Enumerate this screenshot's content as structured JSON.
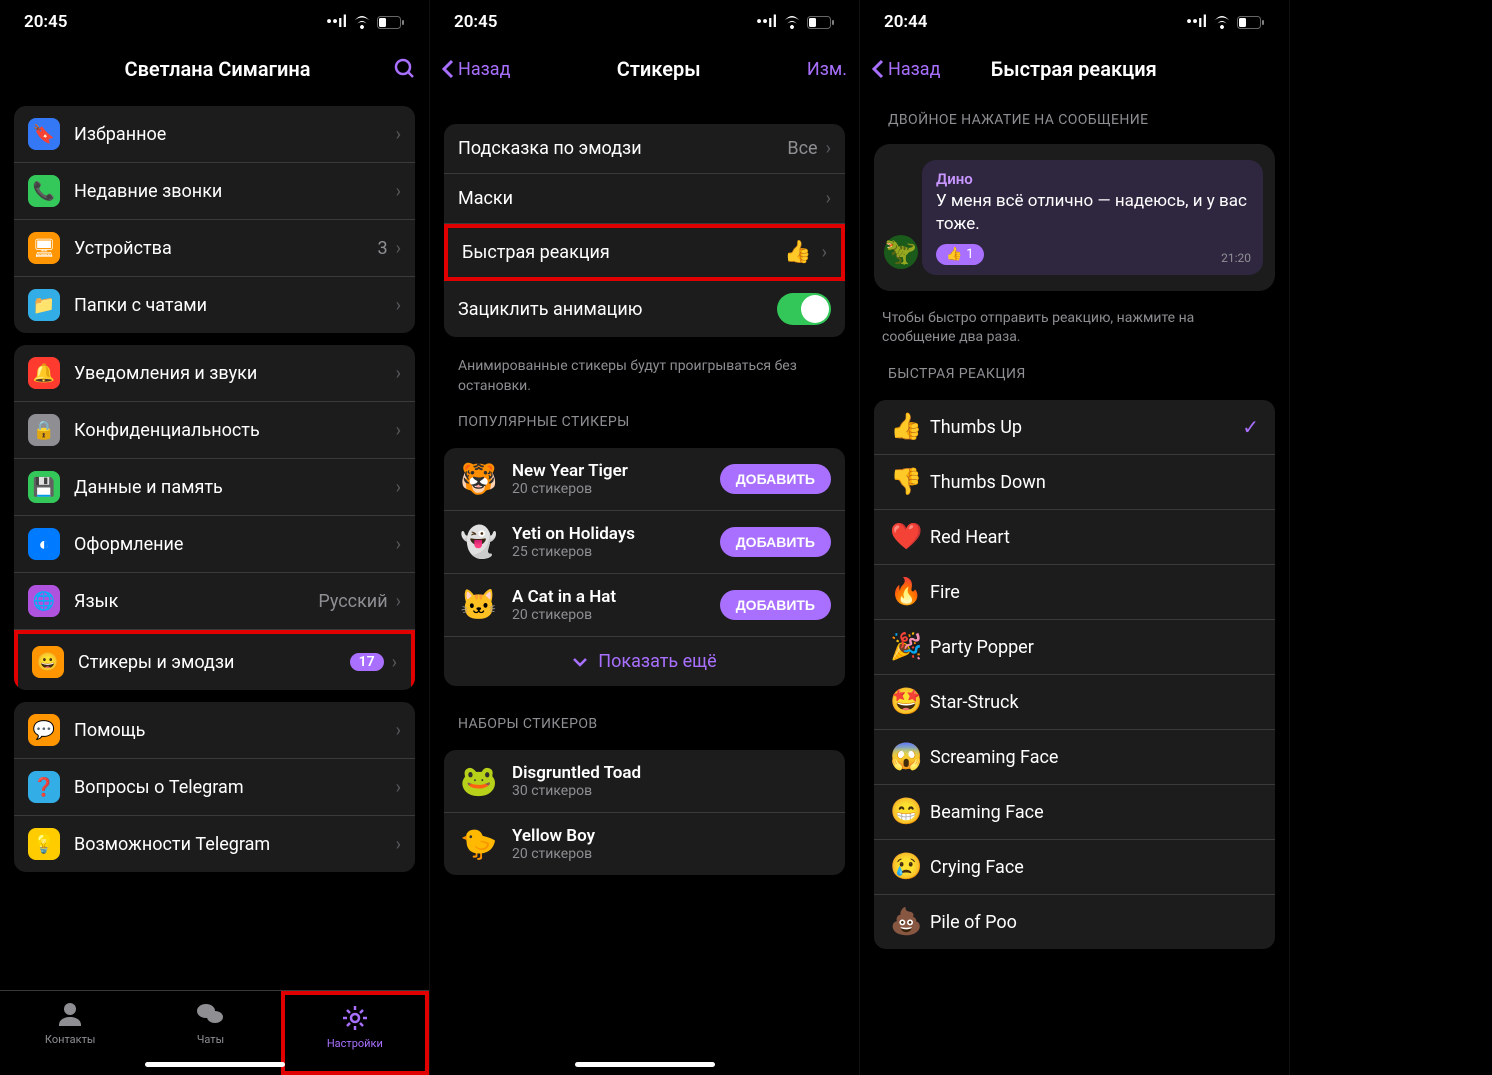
{
  "screen1": {
    "status_time": "20:45",
    "title": "Светлана Симагина",
    "group1": [
      {
        "icon": "🔖",
        "icon_bg": "#3478f6",
        "label": "Избранное"
      },
      {
        "icon": "📞",
        "icon_bg": "#34c759",
        "label": "Недавние звонки"
      },
      {
        "icon": "🖥",
        "icon_bg": "#ff9500",
        "label": "Устройства",
        "value": "3"
      },
      {
        "icon": "📁",
        "icon_bg": "#32ade6",
        "label": "Папки с чатами"
      }
    ],
    "group2": [
      {
        "icon": "🔔",
        "icon_bg": "#ff3b30",
        "label": "Уведомления и звуки"
      },
      {
        "icon": "🔒",
        "icon_bg": "#8e8e93",
        "label": "Конфиденциальность"
      },
      {
        "icon": "💾",
        "icon_bg": "#34c759",
        "label": "Данные и память"
      },
      {
        "icon": "◐",
        "icon_bg": "#007aff",
        "label": "Оформление"
      },
      {
        "icon": "🌐",
        "icon_bg": "#af52de",
        "label": "Язык",
        "value": "Русский"
      },
      {
        "icon": "😀",
        "icon_bg": "#ff9500",
        "label": "Стикеры и эмодзи",
        "badge": "17",
        "highlight": true
      }
    ],
    "group3": [
      {
        "icon": "💬",
        "icon_bg": "#ff9500",
        "label": "Помощь"
      },
      {
        "icon": "❓",
        "icon_bg": "#32ade6",
        "label": "Вопросы о Telegram"
      },
      {
        "icon": "💡",
        "icon_bg": "#ffcc00",
        "label": "Возможности Telegram"
      }
    ],
    "tabs": [
      {
        "label": "Контакты"
      },
      {
        "label": "Чаты"
      },
      {
        "label": "Настройки",
        "active": true,
        "highlight": true
      }
    ]
  },
  "screen2": {
    "status_time": "20:45",
    "back": "Назад",
    "title": "Стикеры",
    "edit": "Изм.",
    "rows": [
      {
        "label": "Подсказка по эмодзи",
        "value": "Все"
      },
      {
        "label": "Маски"
      },
      {
        "label": "Быстрая реакция",
        "emoji": "👍",
        "highlight": true
      },
      {
        "label": "Зациклить анимацию",
        "toggle": true
      }
    ],
    "footer1": "Анимированные стикеры будут проигрываться без остановки.",
    "popular_header": "ПОПУЛЯРНЫЕ СТИКЕРЫ",
    "popular": [
      {
        "thumb": "🐯",
        "name": "New Year Tiger",
        "count": "20 стикеров",
        "btn": "ДОБАВИТЬ"
      },
      {
        "thumb": "👻",
        "name": "Yeti on Holidays",
        "count": "25 стикеров",
        "btn": "ДОБАВИТЬ"
      },
      {
        "thumb": "🐱",
        "name": "A Cat in a Hat",
        "count": "20 стикеров",
        "btn": "ДОБАВИТЬ"
      }
    ],
    "show_more": "Показать ещё",
    "sets_header": "НАБОРЫ СТИКЕРОВ",
    "sets": [
      {
        "thumb": "🐸",
        "name": "Disgruntled Toad",
        "count": "30 стикеров"
      },
      {
        "thumb": "🐤",
        "name": "Yellow Boy",
        "count": "20 стикеров"
      }
    ]
  },
  "screen3": {
    "status_time": "20:44",
    "back": "Назад",
    "title": "Быстрая реакция",
    "preview_header": "ДВОЙНОЕ НАЖАТИЕ НА СООБЩЕНИЕ",
    "msg_name": "Дино",
    "msg_text": "У меня всё отлично — надеюсь, и у вас тоже.",
    "msg_time": "21:20",
    "reaction_count": "1",
    "preview_footer": "Чтобы быстро отправить реакцию, нажмите на сообщение два раза.",
    "list_header": "БЫСТРАЯ РЕАКЦИЯ",
    "reactions": [
      {
        "emoji": "👍",
        "label": "Thumbs Up",
        "selected": true
      },
      {
        "emoji": "👎",
        "label": "Thumbs Down"
      },
      {
        "emoji": "❤️",
        "label": "Red Heart"
      },
      {
        "emoji": "🔥",
        "label": "Fire"
      },
      {
        "emoji": "🎉",
        "label": "Party Popper"
      },
      {
        "emoji": "🤩",
        "label": "Star-Struck"
      },
      {
        "emoji": "😱",
        "label": "Screaming Face"
      },
      {
        "emoji": "😁",
        "label": "Beaming Face"
      },
      {
        "emoji": "😢",
        "label": "Crying Face"
      },
      {
        "emoji": "💩",
        "label": "Pile of Poo"
      }
    ]
  }
}
